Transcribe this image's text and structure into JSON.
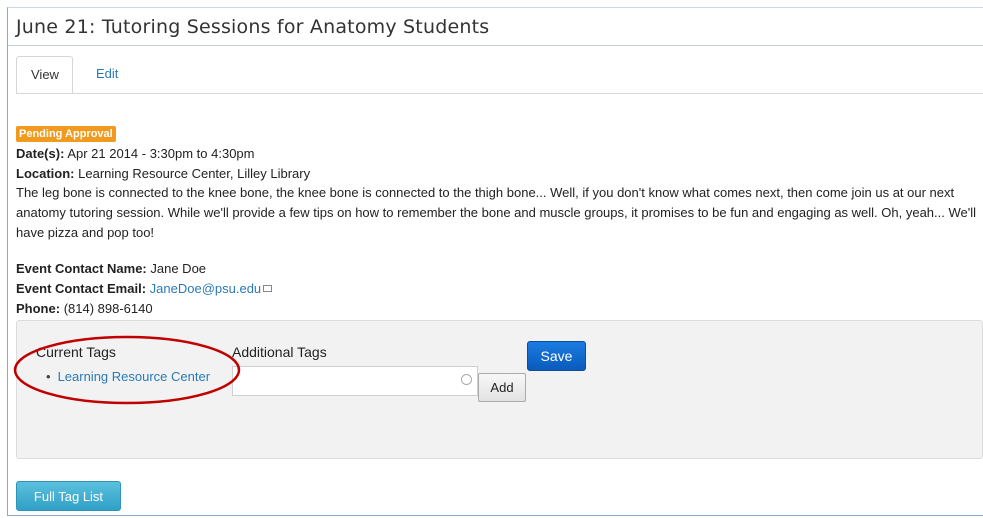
{
  "page": {
    "title": "June 21: Tutoring Sessions for Anatomy Students",
    "tabs": [
      {
        "label": "View",
        "active": true
      },
      {
        "label": "Edit",
        "active": false
      }
    ]
  },
  "event": {
    "status_badge": "Pending Approval",
    "dates_label": "Date(s):",
    "dates_value": "Apr 21 2014 - 3:30pm to 4:30pm",
    "location_label": "Location:",
    "location_value": "Learning Resource Center, Lilley Library",
    "description": "The leg bone is connected to the knee bone, the knee bone is connected to the thigh bone...  Well, if you don't know what comes next, then come join us at our next anatomy tutoring session.  While we'll provide a few tips on how to remember the bone and muscle groups, it promises to be fun and engaging as well.  Oh, yeah... We'll have pizza and pop too!",
    "contact_name_label": "Event Contact Name:",
    "contact_name_value": "Jane Doe",
    "contact_email_label": "Event Contact Email:",
    "contact_email_value": "JaneDoe@psu.edu",
    "phone_label": "Phone:",
    "phone_value": "(814) 898-6140"
  },
  "tags": {
    "current_heading": "Current Tags",
    "current": [
      "Learning Resource Center"
    ],
    "additional_heading": "Additional Tags",
    "input_value": "",
    "add_label": "Add",
    "save_label": "Save",
    "full_list_label": "Full Tag List"
  },
  "colors": {
    "badge": "#f09a1e",
    "link": "#2a7ab8",
    "save": "#0a5bbd",
    "full_list": "#5bc0de",
    "annotation": "#c00000"
  }
}
